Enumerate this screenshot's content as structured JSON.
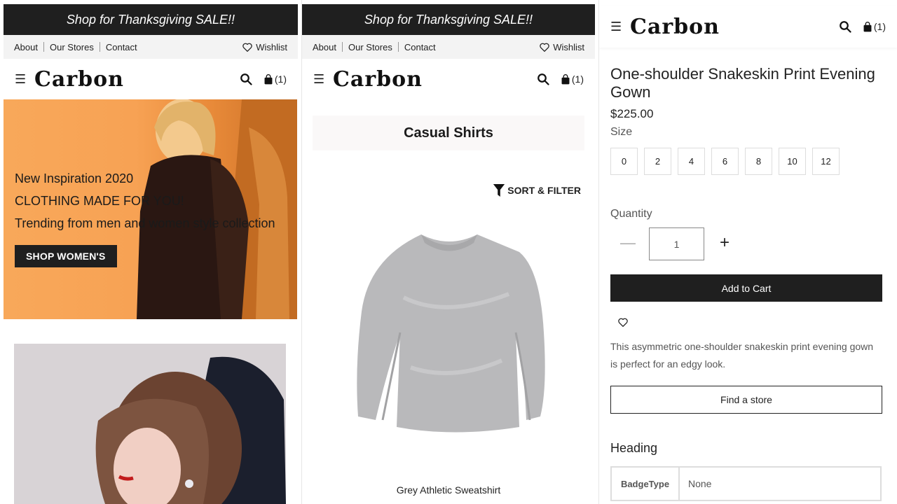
{
  "promo": {
    "text": "Shop for Thanksgiving SALE!!"
  },
  "utility": {
    "about": "About",
    "stores": "Our Stores",
    "contact": "Contact",
    "wishlist": "Wishlist"
  },
  "brand": {
    "logo": "Carbon",
    "cart_count": "(1)"
  },
  "icons": {
    "menu": "hamburger-icon",
    "search": "search-icon",
    "cart": "shopping-bag-icon",
    "wishlist": "heart-icon",
    "filter": "filter-icon"
  },
  "home": {
    "hero_line1": "New Inspiration 2020",
    "hero_line2": "CLOTHING MADE FOR YOU!",
    "hero_line3": "Trending from men and women style collection",
    "hero_button": "SHOP WOMEN'S"
  },
  "category": {
    "title": "Casual Shirts",
    "sort_filter": "SORT & FILTER",
    "product_name": "Grey Athletic Sweatshirt"
  },
  "product": {
    "title": "One-shoulder Snakeskin Print Evening Gown",
    "price": "$225.00",
    "size_label": "Size",
    "sizes": [
      "0",
      "2",
      "4",
      "6",
      "8",
      "10",
      "12"
    ],
    "quantity_label": "Quantity",
    "quantity_minus": "—",
    "quantity_value": "1",
    "quantity_plus": "+",
    "add_to_cart": "Add to Cart",
    "description": "This asymmetric one-shoulder snakeskin print evening gown is perfect for an edgy look.",
    "find_store": "Find a store",
    "heading": "Heading",
    "attr_key": "BadgeType",
    "attr_value": "None"
  },
  "colors": {
    "dark": "#1f1f1f",
    "hero_orange": "#f7a254",
    "utility_bg": "#f3f3f3"
  }
}
